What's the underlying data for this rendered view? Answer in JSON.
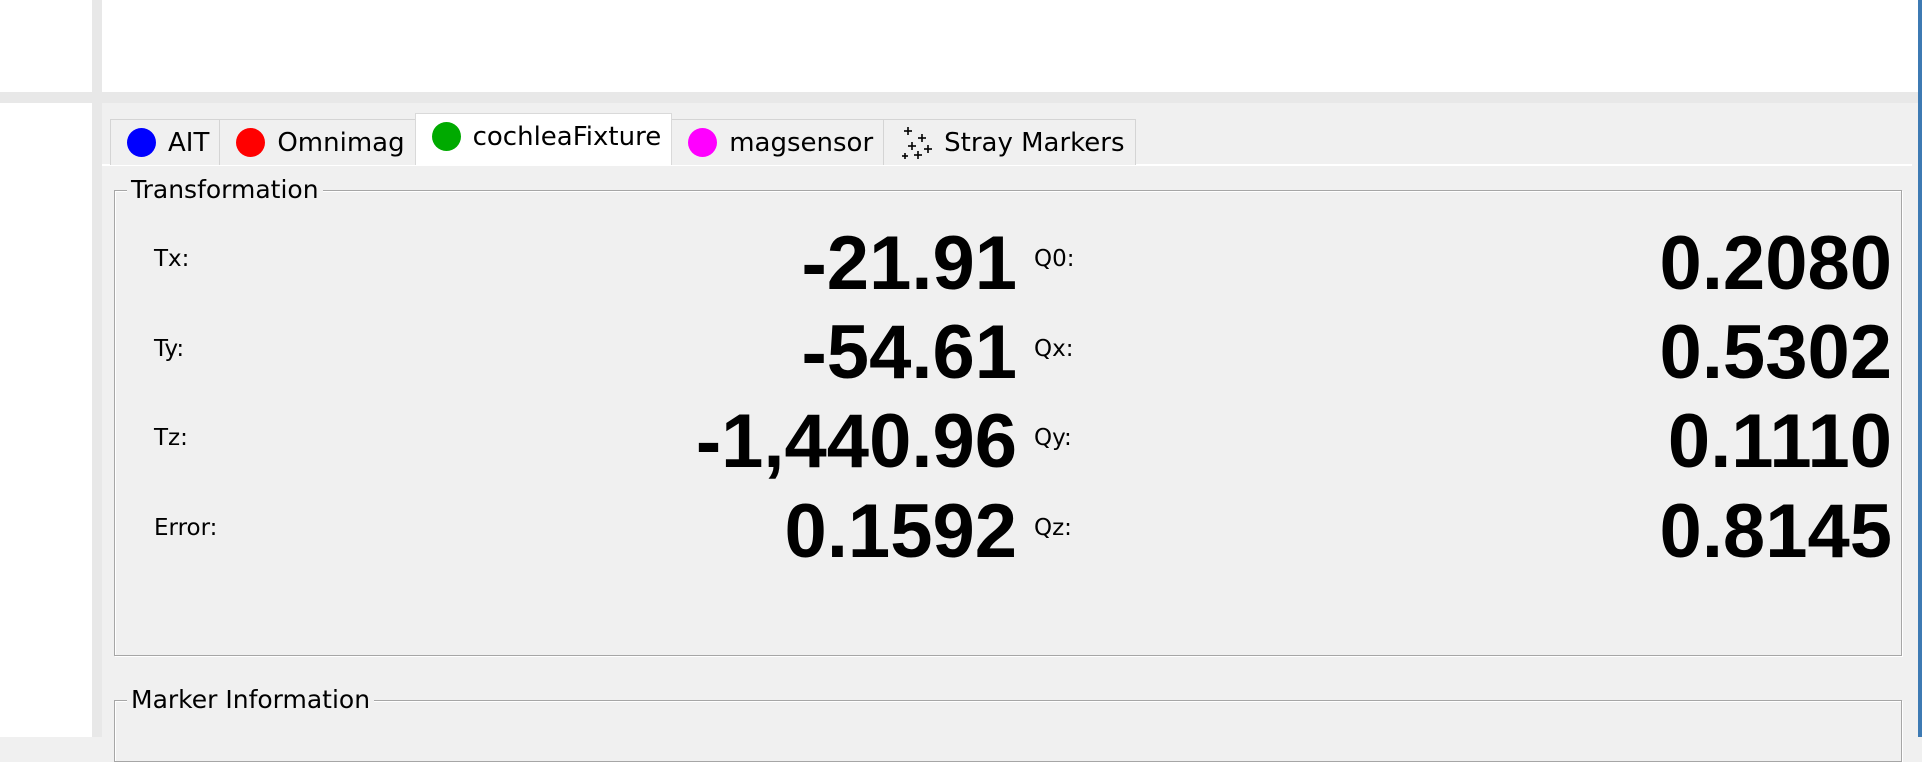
{
  "tabs": [
    {
      "label": "AIT",
      "color": "#0000ff"
    },
    {
      "label": "Omnimag",
      "color": "#ff0000"
    },
    {
      "label": "cochleaFixture",
      "color": "#00aa00"
    },
    {
      "label": "magsensor",
      "color": "#ff00ff"
    },
    {
      "label": "Stray Markers",
      "icon": "stray-markers-icon"
    }
  ],
  "active_tab": "cochleaFixture",
  "transformation": {
    "title": "Transformation",
    "tx_label": "Tx:",
    "tx_value": "-21.91",
    "ty_label": "Ty:",
    "ty_value": "-54.61",
    "tz_label": "Tz:",
    "tz_value": "-1,440.96",
    "error_label": "Error:",
    "error_value": "0.1592",
    "q0_label": "Q0:",
    "q0_value": "0.2080",
    "qx_label": "Qx:",
    "qx_value": "0.5302",
    "qy_label": "Qy:",
    "qy_value": "0.1110",
    "qz_label": "Qz:",
    "qz_value": "0.8145"
  },
  "marker_information": {
    "title": "Marker Information"
  }
}
